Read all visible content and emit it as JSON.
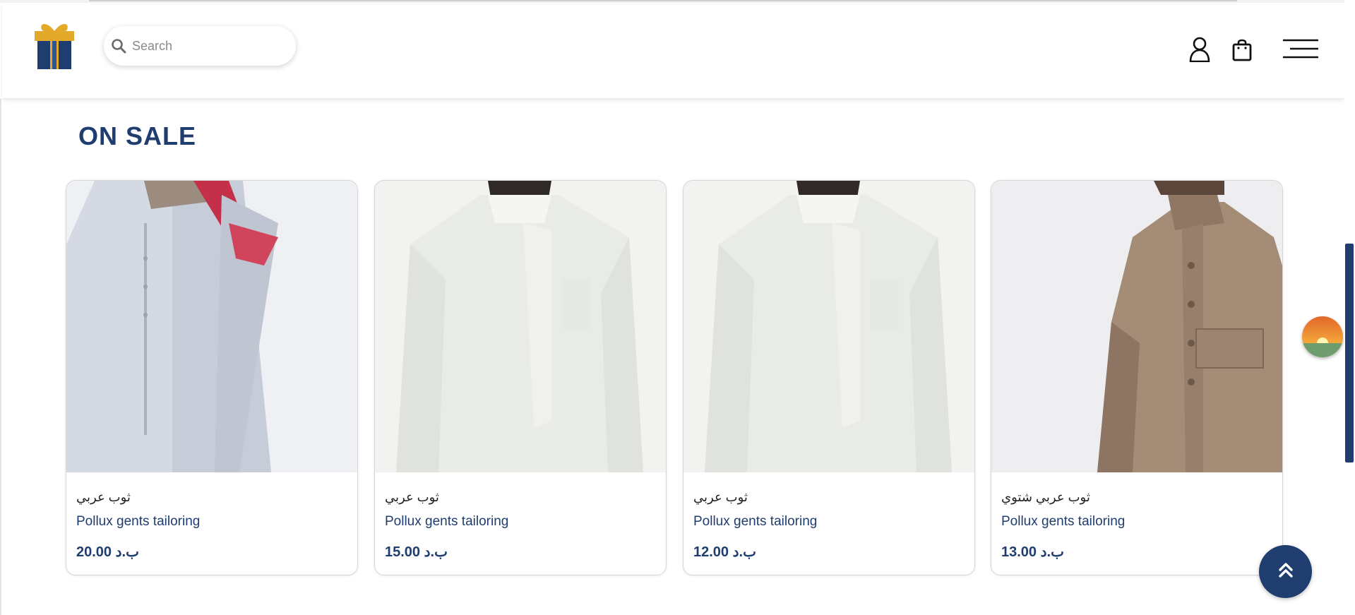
{
  "search": {
    "placeholder": "Search"
  },
  "section": {
    "title": "ON SALE"
  },
  "products": [
    {
      "name_ar": "ثوب عربي",
      "brand": "Pollux gents tailoring",
      "price": "20.00 ب.د"
    },
    {
      "name_ar": "ثوب عربي",
      "brand": "Pollux gents tailoring",
      "price": "15.00 ب.د"
    },
    {
      "name_ar": "ثوب عربي",
      "brand": "Pollux gents tailoring",
      "price": "12.00 ب.د"
    },
    {
      "name_ar": "ثوب عربي شتوي",
      "brand": "Pollux gents tailoring",
      "price": "13.00 ب.د"
    }
  ],
  "icons": {
    "logo": "gift-box-logo",
    "search": "search-icon",
    "user": "user-icon",
    "bag": "shopping-bag-icon",
    "menu": "hamburger-menu-icon",
    "scroll_top": "chevrons-up-icon",
    "widget": "sunset-icon"
  },
  "colors": {
    "brand": "#1f3d6e",
    "gift_gold": "#e3a92b"
  }
}
